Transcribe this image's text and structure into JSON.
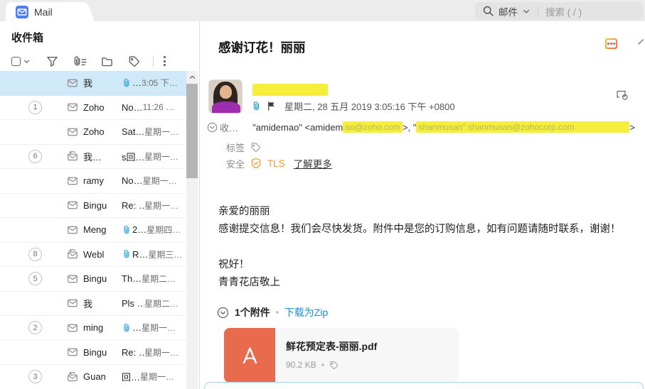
{
  "app": {
    "tab_label": "Mail"
  },
  "search": {
    "scope": "邮件",
    "placeholder": "搜索 ( / )"
  },
  "inbox": {
    "title": "收件箱",
    "rows": [
      {
        "badge": "",
        "sender": "我",
        "subject": "…",
        "time": "3:05 下…",
        "selected": true,
        "has_clip": true
      },
      {
        "badge": "1",
        "sender": "Zoho",
        "subject": "No…",
        "time": "11:26 …"
      },
      {
        "badge": "",
        "sender": "Zoho",
        "subject": "Sat…",
        "time": "星期一…"
      },
      {
        "badge": "6",
        "sender": "我…",
        "subject": "s回…",
        "time": "星期一…",
        "replied": true
      },
      {
        "badge": "",
        "sender": "ramy",
        "subject": "No…",
        "time": "星期一…"
      },
      {
        "badge": "",
        "sender": "Bingu",
        "subject": "Re: …",
        "time": "星期一…"
      },
      {
        "badge": "",
        "sender": "Meng",
        "subject": "2…",
        "time": "星期四…",
        "has_clip": true
      },
      {
        "badge": "8",
        "sender": "Webl",
        "subject": "R…",
        "time": "星期三…",
        "has_clip": true,
        "replied": true
      },
      {
        "badge": "5",
        "sender": "Bingu",
        "subject": "Th…",
        "time": "星期二…"
      },
      {
        "badge": "",
        "sender": "我",
        "subject": "Pls …",
        "time": "星期二…"
      },
      {
        "badge": "2",
        "sender": "ming",
        "subject": "…",
        "time": "星期一…",
        "has_clip": true
      },
      {
        "badge": "",
        "sender": "Bingu",
        "subject": "Re: …",
        "time": "星期一…"
      },
      {
        "badge": "3",
        "sender": "Guan",
        "subject": "回…",
        "time": "星期一…",
        "replied": true
      }
    ]
  },
  "message": {
    "subject": "感谢订花！丽丽",
    "date": "星期二, 28 五月 2019 3:05:16 下午 +0800",
    "to_label": "收…",
    "to_prefix": "\"amidemao\" <amidem",
    "to_redacted1": "ao@zoho.com",
    "to_mid": ">, \"",
    "to_redacted2": "shanmusan\" shanmusan@zohocorp.com",
    "to_suffix": ">",
    "labels_label": "标签",
    "security_label": "安全",
    "security_value": "TLS",
    "learn_more": "了解更多",
    "body_lines": [
      "亲爱的丽丽",
      "感谢提交信息！我们会尽快发货。附件中是您的订购信息，如有问题请随时联系，谢谢！",
      "",
      "祝好！",
      "青青花店敬上"
    ],
    "attachments_header": {
      "count": "1个附件",
      "download_zip": "下载为Zip"
    },
    "attachment": {
      "filename": "鲜花预定表-丽丽.pdf",
      "size": "90.2 KB"
    }
  },
  "colors": {
    "topbar_bg": "#ececec",
    "selected_row": "#cfe9f8",
    "highlight_yellow": "#f6ee3d",
    "link_blue": "#1592d2",
    "tls_orange": "#ef9b3d",
    "pdf_orange": "#e96b4e",
    "tab_icon_blue": "#4f7df0",
    "clip_blue": "#2b9fd9"
  }
}
